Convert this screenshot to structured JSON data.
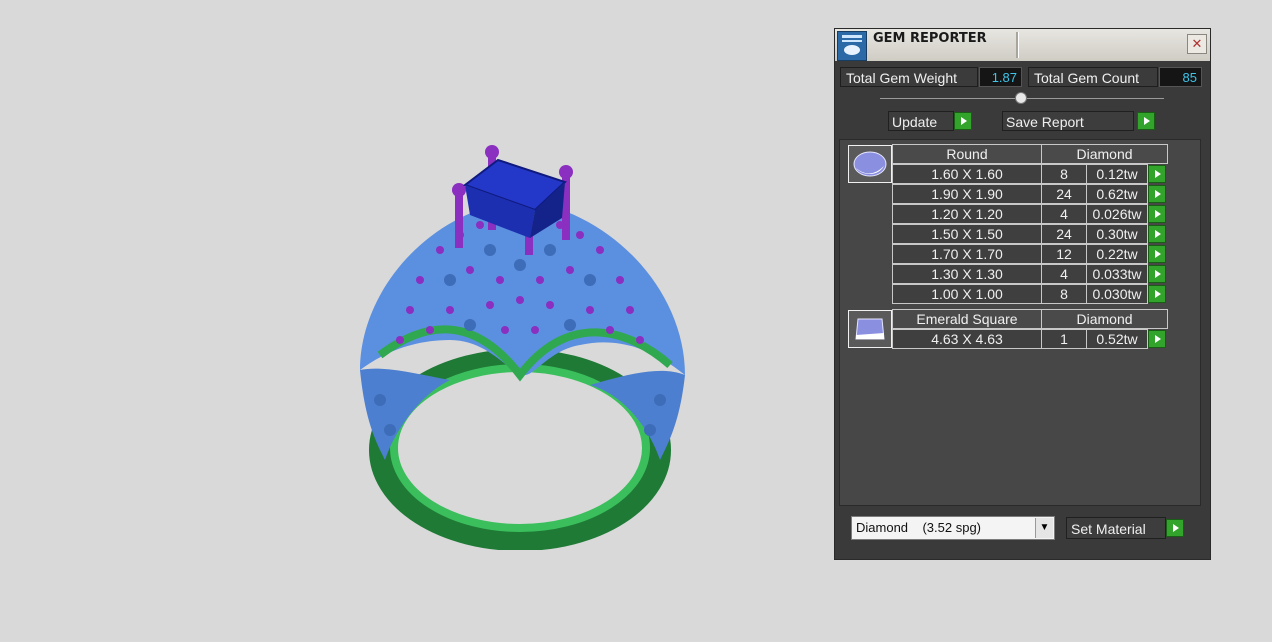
{
  "panel": {
    "title": "GEM REPORTER",
    "close_glyph": "✕",
    "total_weight_label": "Total Gem Weight",
    "total_weight_value": "1.87",
    "total_count_label": "Total Gem Count",
    "total_count_value": "85",
    "update_label": "Update",
    "save_report_label": "Save Report",
    "set_material_label": "Set Material",
    "material_value": "Diamond    (3.52 spg)",
    "select_arrow": "▼"
  },
  "groups": [
    {
      "icon": "round-gem-icon",
      "cut": "Round",
      "material": "Diamond",
      "rows": [
        {
          "size": "1.60 X 1.60",
          "count": "8",
          "weight": "0.12tw"
        },
        {
          "size": "1.90 X 1.90",
          "count": "24",
          "weight": "0.62tw"
        },
        {
          "size": "1.20 X 1.20",
          "count": "4",
          "weight": "0.026tw"
        },
        {
          "size": "1.50 X 1.50",
          "count": "24",
          "weight": "0.30tw"
        },
        {
          "size": "1.70 X 1.70",
          "count": "12",
          "weight": "0.22tw"
        },
        {
          "size": "1.30 X 1.30",
          "count": "4",
          "weight": "0.033tw"
        },
        {
          "size": "1.00 X 1.00",
          "count": "8",
          "weight": "0.030tw"
        }
      ]
    },
    {
      "icon": "emerald-square-gem-icon",
      "cut": "Emerald Square",
      "material": "Diamond",
      "rows": [
        {
          "size": "4.63 X 4.63",
          "count": "1",
          "weight": "0.52tw"
        }
      ]
    }
  ],
  "colors": {
    "ring_metal": "#2fa84f",
    "prongs": "#8a2fc0",
    "pave_gems": "#4f8fe0",
    "center_stone": "#1b2fb0",
    "value_text": "#3fc4ea",
    "go_button": "#32a42b"
  }
}
